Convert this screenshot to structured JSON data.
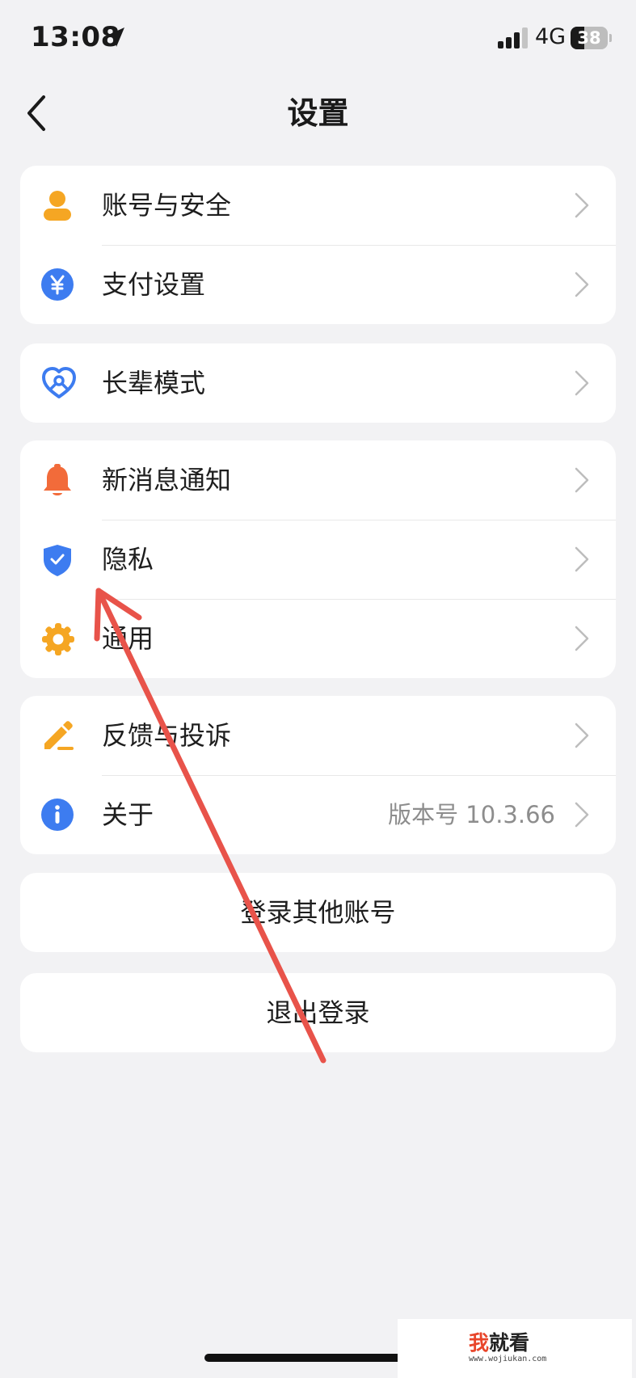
{
  "status_bar": {
    "time": "13:08",
    "network": "4G",
    "battery": "38",
    "battery_level_percent": 38
  },
  "nav": {
    "title": "设置",
    "back_icon": "chevron-left-icon"
  },
  "groups": [
    {
      "items": [
        {
          "label": "账号与安全",
          "icon": "user-icon",
          "color": "#f5a623"
        },
        {
          "label": "支付设置",
          "icon": "yuan-icon",
          "color": "#3d7cf0"
        }
      ]
    },
    {
      "items": [
        {
          "label": "长辈模式",
          "icon": "heart-icon",
          "color": "#3d7cf0"
        }
      ]
    },
    {
      "items": [
        {
          "label": "新消息通知",
          "icon": "bell-icon",
          "color": "#f26b3a"
        },
        {
          "label": "隐私",
          "icon": "shield-icon",
          "color": "#3d7cf0"
        },
        {
          "label": "通用",
          "icon": "gear-icon",
          "color": "#f5a623"
        }
      ]
    },
    {
      "items": [
        {
          "label": "反馈与投诉",
          "icon": "pencil-icon",
          "color": "#f5a623"
        },
        {
          "label": "关于",
          "icon": "info-icon",
          "color": "#3d7cf0",
          "value": "版本号 10.3.66"
        }
      ]
    }
  ],
  "buttons": {
    "switch_account": "登录其他账号",
    "logout": "退出登录"
  },
  "watermark": {
    "first_char": "我",
    "rest": "就看",
    "url": "www.wojiukan.com"
  },
  "annotation_color": "#e8534a"
}
